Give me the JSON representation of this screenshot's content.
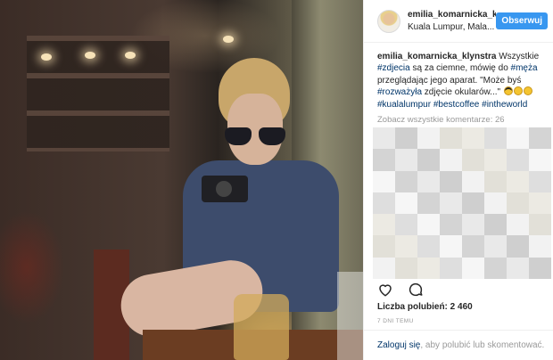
{
  "post": {
    "username": "emilia_komarnicka_klyn",
    "location": "Kuala Lumpur, Mala...",
    "follow_label": "Obserwuj"
  },
  "caption": {
    "username": "emilia_komarnicka_klynstra",
    "t1": " Wszystkie ",
    "tag1": "#zdjecia",
    "t2": " są za ciemne, mówię do ",
    "tag2": "#męża",
    "t3": " przeglądając jego aparat. \"Może byś ",
    "tag3": "#rozważyła",
    "t4": " zdjęcie okularów...\" ",
    "tag4": "#kualalumpur",
    "tag5": "#bestcoffee",
    "tag6": "#intheworld"
  },
  "comments": {
    "view_all": "Zobacz wszystkie komentarze: 26"
  },
  "stats": {
    "likes": "Liczba polubień: 2 460",
    "time": "7 DNI TEMU"
  },
  "login": {
    "link": "Zaloguj się",
    "rest": ", aby polubić lub skomentować."
  },
  "icons": {
    "like": "heart-icon",
    "comment": "comment-bubble-icon"
  },
  "colors": {
    "accent": "#3897f0",
    "hashtag": "#003569",
    "muted": "#999999"
  }
}
